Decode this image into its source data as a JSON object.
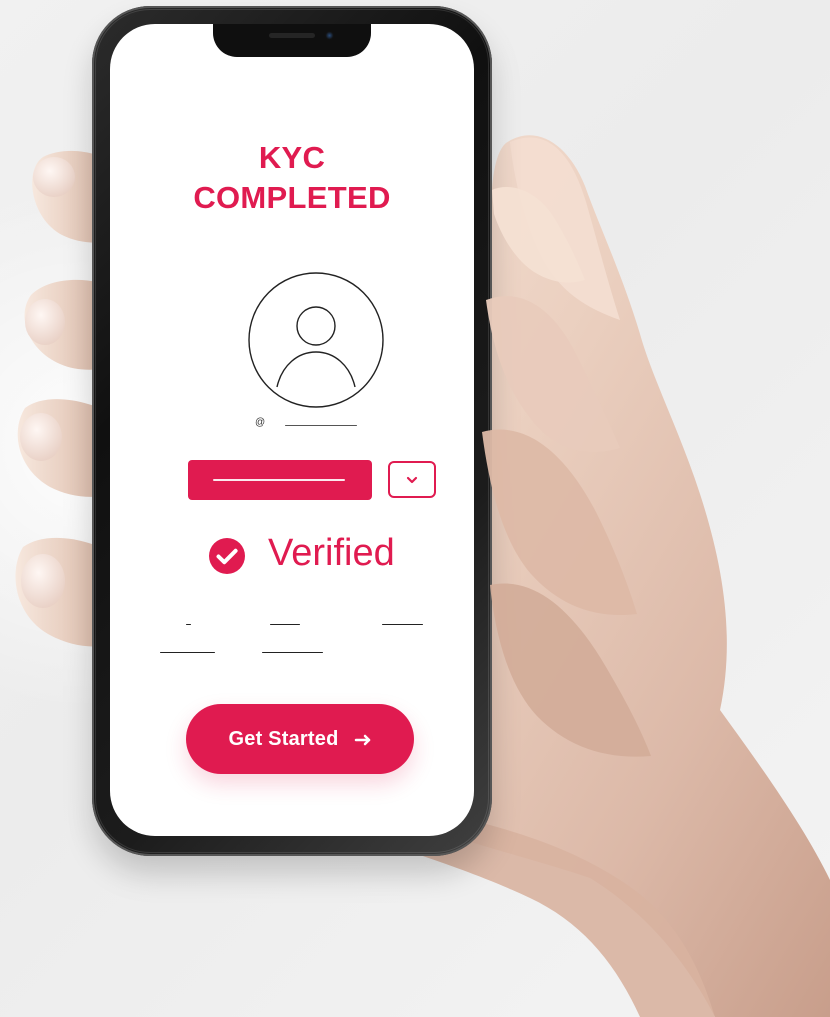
{
  "colors": {
    "accent": "#e01b50",
    "screen_background": "#ffffff",
    "phone_frame": "#111111",
    "hand_skin": "#ead2c3"
  },
  "screen": {
    "title_line_1": "KYC",
    "title_line_2": "COMPLETED",
    "handle_symbol": "@",
    "verified_label": "Verified",
    "button_label": "Get Started"
  },
  "icons": {
    "avatar": "user-avatar-icon",
    "dropdown": "chevron-down-icon",
    "verified": "check-circle-icon",
    "arrow": "arrow-right-icon"
  }
}
